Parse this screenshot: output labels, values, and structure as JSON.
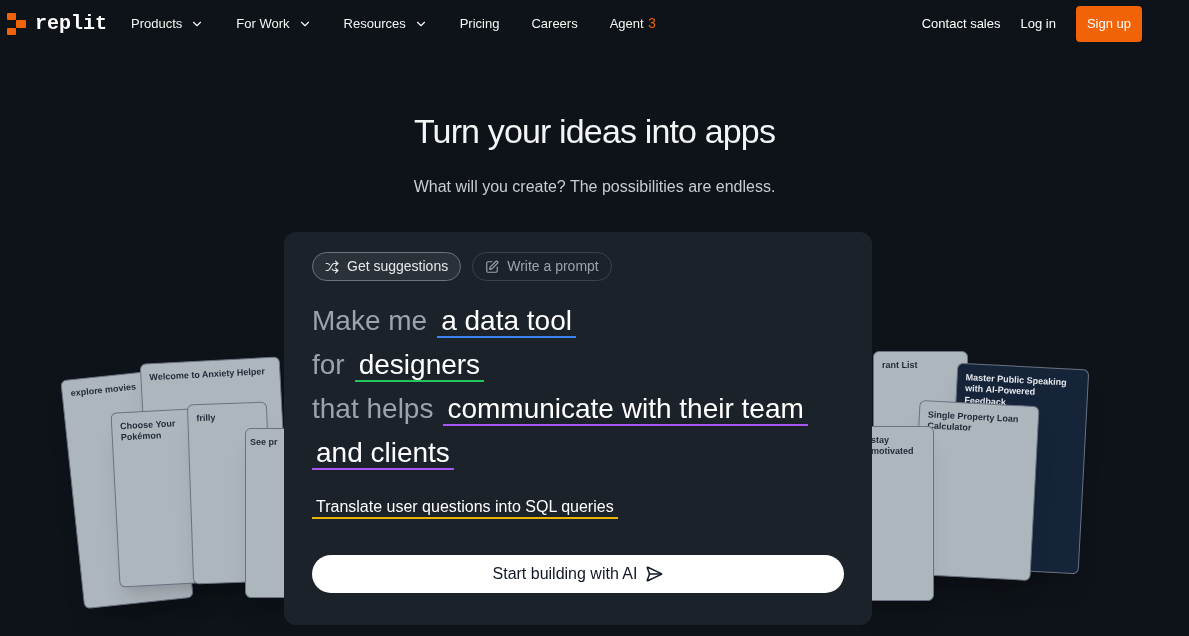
{
  "nav": {
    "brand": "replit",
    "items": [
      {
        "label": "Products",
        "dropdown": true
      },
      {
        "label": "For Work",
        "dropdown": true
      },
      {
        "label": "Resources",
        "dropdown": true
      },
      {
        "label": "Pricing",
        "dropdown": false
      },
      {
        "label": "Careers",
        "dropdown": false
      },
      {
        "label": "Agent",
        "badge": "3",
        "dropdown": false
      }
    ],
    "right": [
      {
        "label": "Contact sales",
        "kind": "link"
      },
      {
        "label": "Log in",
        "kind": "link"
      },
      {
        "label": "Sign up",
        "kind": "primary"
      }
    ]
  },
  "hero": {
    "title": "Turn your ideas into apps",
    "subtitle": "What will you create? The possibilities are endless."
  },
  "previews": {
    "left": [
      {
        "title": "explore movies"
      },
      {
        "title": "Welcome to Anxiety Helper"
      },
      {
        "title": "Choose Your Pokémon"
      },
      {
        "title": "frilly"
      },
      {
        "title": "See pr"
      }
    ],
    "right": [
      {
        "title": "rant List"
      },
      {
        "title": "Master Public Speaking with **AI-Powered Feedback**"
      },
      {
        "title": "Single Property Loan Calculator"
      },
      {
        "title": "stay motivated"
      }
    ]
  },
  "composer": {
    "modes": [
      {
        "label": "Get suggestions",
        "selected": true,
        "kind": "shuffle"
      },
      {
        "label": "Write a prompt",
        "selected": false,
        "kind": "edit"
      }
    ],
    "prompt": [
      {
        "prefix": "Make me",
        "value": [
          "a data tool"
        ],
        "color": "#3b82f6"
      },
      {
        "prefix": "for",
        "value": [
          "designers"
        ],
        "color": "#22c55e"
      },
      {
        "prefix": "that helps",
        "value": [
          "communicate with their team",
          "and clients"
        ],
        "color": "#a855f7"
      }
    ],
    "suggestion": {
      "text": "Translate user questions into SQL queries",
      "color": "#eab308"
    },
    "button": "Start building with AI"
  }
}
